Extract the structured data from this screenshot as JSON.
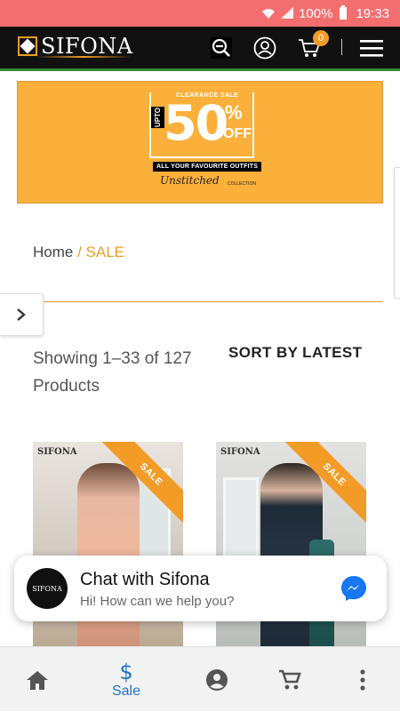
{
  "status_bar": {
    "battery": "100%",
    "time": "19:33"
  },
  "header": {
    "brand": "SIFONA",
    "cart_count": "0",
    "icons": [
      "zoom-out-icon",
      "user-circle-icon",
      "cart-icon",
      "hamburger-menu-icon"
    ]
  },
  "banner": {
    "headline": "CLEARANCE SALE",
    "upto": "UPTO",
    "percent": "50",
    "percent_sign": "%",
    "off": "OFF",
    "tagline": "ALL YOUR FAVOURITE OUTFITS",
    "script": "Unstitched",
    "collection": "COLLECTION",
    "bg_color": "#fbb03b"
  },
  "breadcrumb": {
    "home": "Home",
    "separator": " / ",
    "current": "SALE"
  },
  "listing": {
    "showing": "Showing 1–33 of 127 Products",
    "sort_label": "SORT BY LATEST"
  },
  "products": [
    {
      "badge": "SALE",
      "brand_mark": "SIFONA"
    },
    {
      "badge": "SALE",
      "brand_mark": "SIFONA"
    }
  ],
  "chat_widget": {
    "avatar_text": "SIFONA",
    "title": "Chat with Sifona",
    "subtitle": "Hi! How can we help you?"
  },
  "bottom_nav": {
    "items": [
      {
        "icon": "home-icon",
        "label": ""
      },
      {
        "icon": "dollar-icon",
        "label": "Sale"
      },
      {
        "icon": "account-icon",
        "label": ""
      },
      {
        "icon": "cart-icon",
        "label": ""
      },
      {
        "icon": "more-vert-icon",
        "label": ""
      }
    ]
  },
  "colors": {
    "status_bar": "#f36f6f",
    "header": "#111111",
    "accent": "#f29b26",
    "nav_active": "#1a73c8",
    "messenger": "#1877f2"
  }
}
